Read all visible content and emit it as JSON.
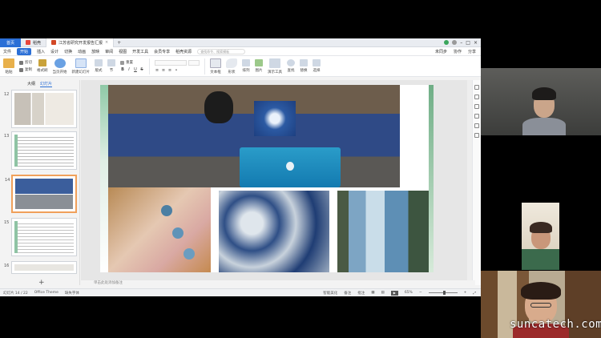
{
  "titlebar": {
    "home_tab": "首页",
    "tabs": [
      {
        "label": "稻壳",
        "active": false
      },
      {
        "label": "江苏省研究开发报告汇报",
        "active": true
      }
    ],
    "plus": "+"
  },
  "menubar": {
    "file": "文件",
    "items": [
      "开始",
      "插入",
      "设计",
      "切换",
      "动画",
      "放映",
      "审阅",
      "视图",
      "开发工具",
      "会员专享",
      "稻壳资源"
    ],
    "active": "开始",
    "search_placeholder": "查找命令、搜索模板",
    "right_items": [
      "未同步",
      "协作",
      "分享"
    ]
  },
  "ribbon": {
    "buttons": [
      "粘贴",
      "剪切",
      "复制",
      "格式刷",
      "当页开始",
      "新建幻灯片",
      "版式",
      "节",
      "重置"
    ],
    "font_name": "",
    "font_size": "",
    "right_buttons": [
      "文本框",
      "形状",
      "排列",
      "图片",
      "演示工具",
      "查找",
      "替换",
      "选择"
    ]
  },
  "left_panel": {
    "tabs": [
      "大纲",
      "幻灯片"
    ],
    "active_tab": "幻灯片",
    "slides": [
      {
        "num": "12",
        "selected": false
      },
      {
        "num": "13",
        "selected": false
      },
      {
        "num": "14",
        "selected": true
      },
      {
        "num": "15",
        "selected": false
      },
      {
        "num": "16",
        "selected": false
      }
    ],
    "add": "+"
  },
  "notes_placeholder": "单击此处添加备注",
  "status": {
    "slide_counter": "幻灯片 14 / 22",
    "theme": "Office Theme",
    "missing_font": "缺失字体",
    "smart_beautify": "智能美化",
    "notes": "备注",
    "comments": "批注",
    "zoom": "65%"
  },
  "watermark": "suncatech.com",
  "colors": {
    "accent": "#2b6fd6",
    "selected_thumb": "#f0a05a",
    "slide_leaf_accent": "#5aa07a"
  }
}
